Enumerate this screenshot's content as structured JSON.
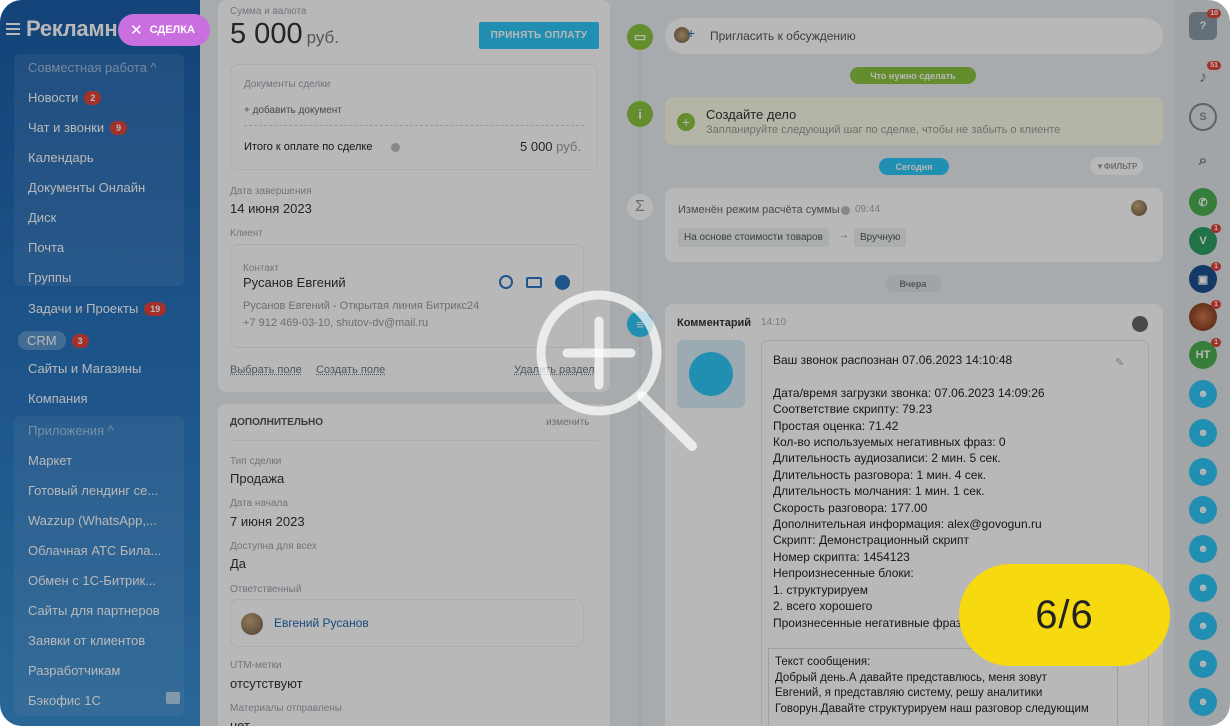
{
  "sidebar": {
    "logo": "Рекламно",
    "deal_pill": "СДЕЛКА",
    "section_collab": "Совместная работа ^",
    "items": [
      {
        "label": "Новости",
        "badge": "2"
      },
      {
        "label": "Чат и звонки",
        "badge": "9"
      },
      {
        "label": "Календарь",
        "badge": ""
      },
      {
        "label": "Документы Онлайн",
        "badge": ""
      },
      {
        "label": "Диск",
        "badge": ""
      },
      {
        "label": "Почта",
        "badge": ""
      },
      {
        "label": "Группы",
        "badge": ""
      },
      {
        "label": "Задачи и Проекты",
        "badge": "19"
      },
      {
        "label": "CRM",
        "badge": "3"
      },
      {
        "label": "Сайты и Магазины",
        "badge": ""
      },
      {
        "label": "Компания",
        "badge": ""
      }
    ],
    "section_apps": "Приложения ^",
    "apps": [
      "Маркет",
      "Готовый лендинг се...",
      "Wazzup (WhatsApp,...",
      "Облачная АТС Била...",
      "Обмен с 1С-Битрик...",
      "Сайты для партнеров",
      "Заявки от клиентов",
      "Разработчикам",
      "Бэкофис 1С"
    ]
  },
  "deal": {
    "sum_label": "Сумма и валюта",
    "amount": "5 000",
    "currency": "руб.",
    "pay_button": "ПРИНЯТЬ ОПЛАТУ",
    "docs_label": "Документы сделки",
    "add_doc": "+ добавить документ",
    "total_label": "Итого к оплате по сделке",
    "total_value": "5 000",
    "total_currency": "руб.",
    "end_date_label": "Дата завершения",
    "end_date": "14 июня 2023",
    "client_label": "Клиент",
    "contact_label": "Контакт",
    "contact_name": "Русанов Евгений",
    "contact_line1": "Русанов Евгений - Открытая линия Битрикс24",
    "contact_line2": "+7 912 469-03-10, shutov-dv@mail.ru",
    "choose_field": "Выбрать поле",
    "create_field": "Создать поле",
    "delete_section": "Удалить раздел"
  },
  "additional": {
    "title": "ДОПОЛНИТЕЛЬНО",
    "edit": "изменить",
    "type_label": "Тип сделки",
    "type": "Продажа",
    "start_label": "Дата начала",
    "start": "7 июня 2023",
    "avail_label": "Доступна для всех",
    "avail": "Да",
    "resp_label": "Ответственный",
    "resp_name": "Евгений Русанов",
    "utm_label": "UTM-метки",
    "utm": "отсутствуют",
    "materials_label": "Материалы отправлены",
    "materials": "нет"
  },
  "timeline": {
    "invite": "Пригласить к обсуждению",
    "todo_pill": "Что нужно сделать",
    "create_task_title": "Создайте дело",
    "create_task_sub": "Запланируйте следующий шаг по сделке, чтобы не забыть о клиенте",
    "today_pill": "Сегодня",
    "filter": "ФИЛЬТР",
    "change_title": "Изменён режим расчёта суммы",
    "change_time": "09:44",
    "chip_from": "На основе стоимости товаров",
    "arrow": "→",
    "chip_to": "Вручную",
    "yesterday_pill": "Вчера",
    "comment_title": "Комментарий",
    "comment_time": "14:10",
    "comment_body": "Ваш звонок распознан 07.06.2023 14:10:48\n\nДата/время загрузки звонка: 07.06.2023 14:09:26\nСоответствие скрипту: 79.23\nПростая оценка: 71.42\nКол-во используемых негативных фраз: 0\nДлительность аудиозаписи: 2 мин. 5 сек.\nДлительность разговора: 1 мин. 4 сек.\nДлительность молчания: 1 мин. 1 сек.\nСкорость разговора: 177.00\nДополнительная информация: alex@govogun.ru\nСкрипт: Демонстрационный скрипт\nНомер скрипта: 1454123\nНепроизнесенные блоки:\n1. структурируем\n2. всего хорошего\nПроизнесенные негативные фразы",
    "message_text": "Текст сообщения:\nДобрый день.А давайте представлюсь, меня зовут\nЕвгений, я представляю систему, решу аналитики\nГоворун.Давайте структурируем наш разговор следующим"
  },
  "rightbar": {
    "help_badge": "10",
    "bell_badge": "51",
    "avatar_v": "V",
    "avatar_nt": "HT"
  },
  "overlay": {
    "counter": "6/6"
  },
  "colors": {
    "sidebar_blue": "#1b5ea8",
    "accent_cyan": "#2fc6f6",
    "deal_purple": "#c96fe0",
    "green": "#8bc53f",
    "counter_yellow": "#f6d90f"
  }
}
